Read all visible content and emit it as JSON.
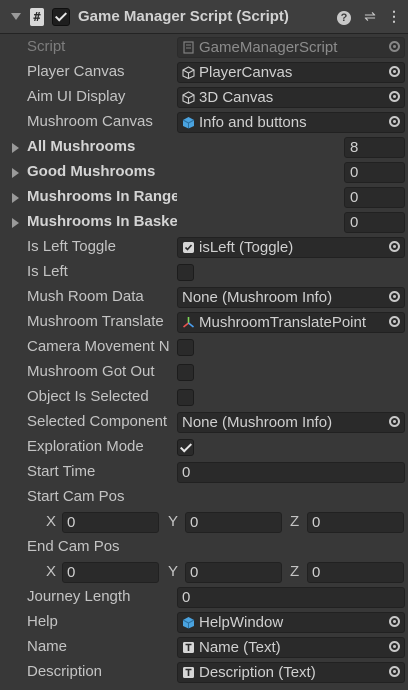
{
  "component": {
    "title": "Game Manager Script (Script)",
    "enabled": true
  },
  "header": {
    "help_icon": "help-icon",
    "presets_icon": "presets-icon",
    "more_icon": "more-icon"
  },
  "fields": {
    "script": {
      "label": "Script",
      "value": "GameManagerScript"
    },
    "player_canvas": {
      "label": "Player Canvas",
      "value": "PlayerCanvas"
    },
    "aim_ui_display": {
      "label": "Aim UI Display",
      "value": "3D Canvas"
    },
    "mushroom_canvas": {
      "label": "Mushroom Canvas",
      "value": "Info and buttons"
    },
    "all_mushrooms": {
      "label": "All Mushrooms",
      "value": "8"
    },
    "good_mushrooms": {
      "label": "Good Mushrooms",
      "value": "0"
    },
    "mushrooms_in_range": {
      "label": "Mushrooms In Range",
      "value": "0"
    },
    "mushrooms_in_basket": {
      "label": "Mushrooms In Basket",
      "value": "0"
    },
    "is_left_toggle": {
      "label": "Is Left Toggle",
      "value": "isLeft (Toggle)"
    },
    "is_left": {
      "label": "Is Left",
      "checked": false
    },
    "mush_room_data": {
      "label": "Mush Room Data",
      "value": "None (Mushroom Info)"
    },
    "mushroom_translate": {
      "label": "Mushroom Translate",
      "value": "MushroomTranslatePoint"
    },
    "camera_movement": {
      "label": "Camera Movement N",
      "checked": false
    },
    "mushroom_got_out": {
      "label": "Mushroom Got Out",
      "checked": false
    },
    "object_is_selected": {
      "label": "Object Is Selected",
      "checked": false
    },
    "selected_component": {
      "label": "Selected Component",
      "value": "None (Mushroom Info)"
    },
    "exploration_mode": {
      "label": "Exploration Mode",
      "checked": true
    },
    "start_time": {
      "label": "Start Time",
      "value": "0"
    },
    "start_cam_pos": {
      "label": "Start Cam Pos",
      "x_label": "X",
      "y_label": "Y",
      "z_label": "Z",
      "x": "0",
      "y": "0",
      "z": "0"
    },
    "end_cam_pos": {
      "label": "End Cam Pos",
      "x_label": "X",
      "y_label": "Y",
      "z_label": "Z",
      "x": "0",
      "y": "0",
      "z": "0"
    },
    "journey_length": {
      "label": "Journey Length",
      "value": "0"
    },
    "help": {
      "label": "Help",
      "value": "HelpWindow"
    },
    "name": {
      "label": "Name",
      "value": "Name (Text)"
    },
    "description": {
      "label": "Description",
      "value": "Description (Text)"
    }
  }
}
